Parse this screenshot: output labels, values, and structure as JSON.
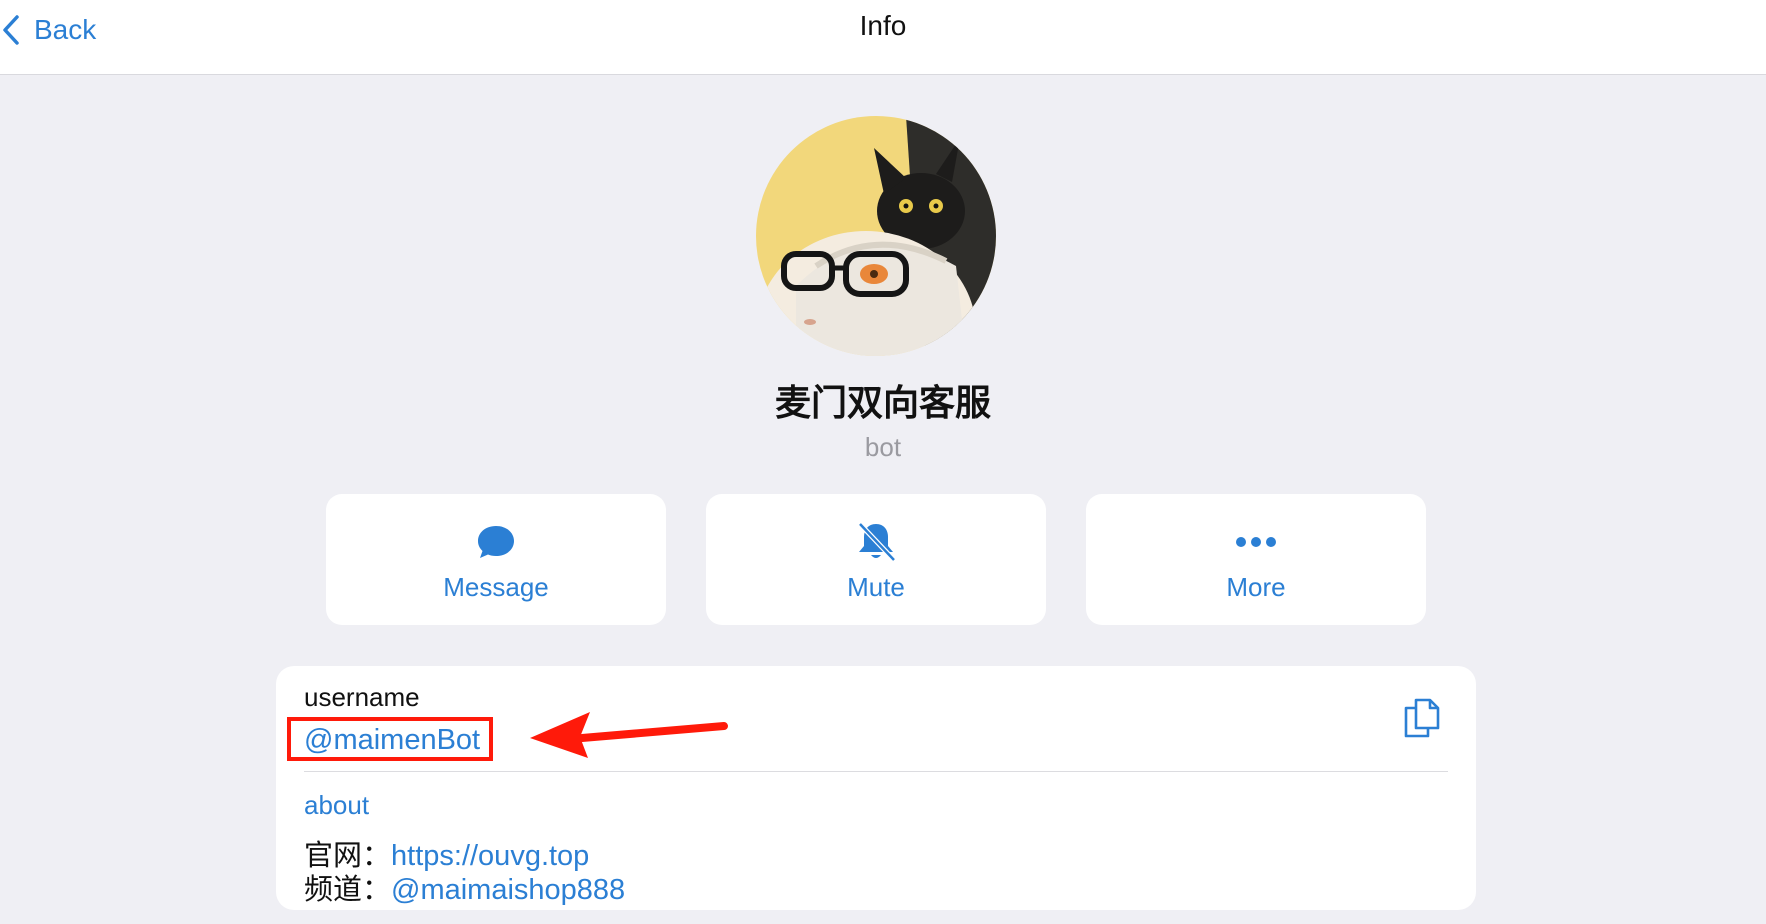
{
  "navbar": {
    "back_label": "Back",
    "title": "Info"
  },
  "profile": {
    "name": "麦门双向客服",
    "subtitle": "bot",
    "avatar_icon": "avatar-image"
  },
  "actions": [
    {
      "label": "Message",
      "icon": "message-bubble-icon"
    },
    {
      "label": "Mute",
      "icon": "bell-muted-icon"
    },
    {
      "label": "More",
      "icon": "more-dots-icon"
    }
  ],
  "info": {
    "username_label": "username",
    "username_value": "@maimenBot",
    "about_label": "about",
    "about_lines": [
      {
        "prefix": "官网：",
        "link": "https://ouvg.top"
      },
      {
        "prefix": "频道：",
        "link": "@maimaishop888"
      }
    ]
  },
  "colors": {
    "accent": "#2b7fd4",
    "background": "#efeff4",
    "annotation": "#ff1a0a"
  }
}
